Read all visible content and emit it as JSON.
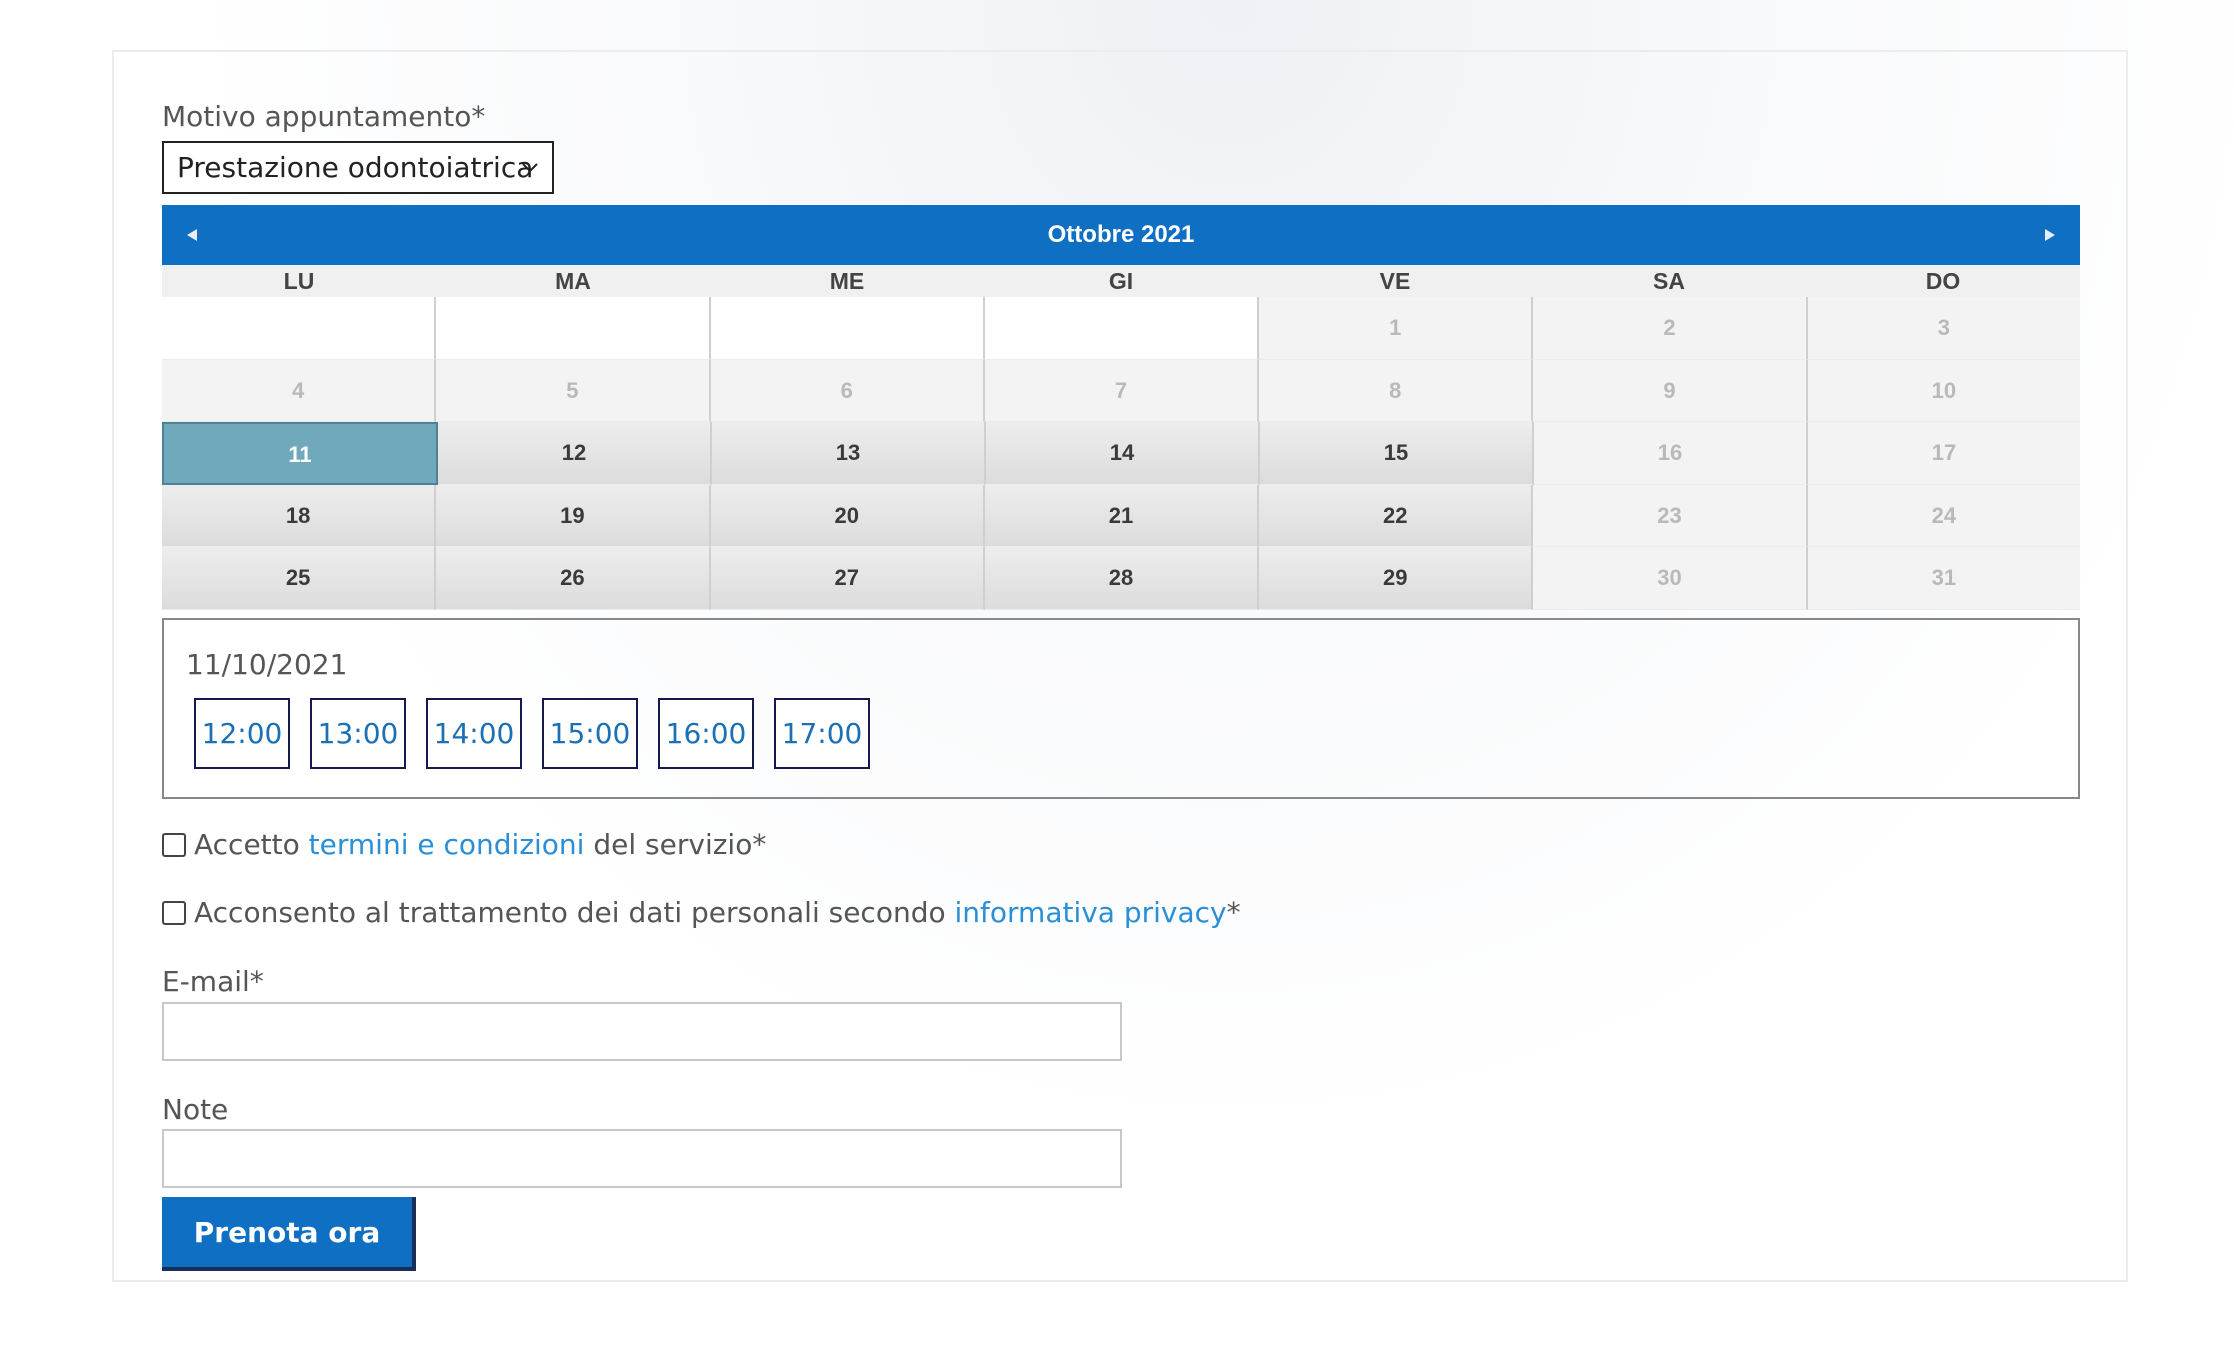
{
  "form": {
    "reason_label": "Motivo appuntamento*",
    "reason_value": "Prestazione odontoiatrica",
    "calendar": {
      "month_title": "Ottobre 2021",
      "prev_icon": "triangle-left-icon",
      "next_icon": "triangle-right-icon",
      "weekdays": [
        "LU",
        "MA",
        "ME",
        "GI",
        "VE",
        "SA",
        "DO"
      ],
      "weeks": [
        [
          {
            "label": "",
            "state": "empty"
          },
          {
            "label": "",
            "state": "empty"
          },
          {
            "label": "",
            "state": "empty"
          },
          {
            "label": "",
            "state": "empty"
          },
          {
            "label": "1",
            "state": "disabled"
          },
          {
            "label": "2",
            "state": "disabled"
          },
          {
            "label": "3",
            "state": "disabled"
          }
        ],
        [
          {
            "label": "4",
            "state": "disabled"
          },
          {
            "label": "5",
            "state": "disabled"
          },
          {
            "label": "6",
            "state": "disabled"
          },
          {
            "label": "7",
            "state": "disabled"
          },
          {
            "label": "8",
            "state": "disabled"
          },
          {
            "label": "9",
            "state": "disabled"
          },
          {
            "label": "10",
            "state": "disabled"
          }
        ],
        [
          {
            "label": "11",
            "state": "selected"
          },
          {
            "label": "12",
            "state": "available"
          },
          {
            "label": "13",
            "state": "available"
          },
          {
            "label": "14",
            "state": "available"
          },
          {
            "label": "15",
            "state": "available"
          },
          {
            "label": "16",
            "state": "disabled"
          },
          {
            "label": "17",
            "state": "disabled"
          }
        ],
        [
          {
            "label": "18",
            "state": "available"
          },
          {
            "label": "19",
            "state": "available"
          },
          {
            "label": "20",
            "state": "available"
          },
          {
            "label": "21",
            "state": "available"
          },
          {
            "label": "22",
            "state": "available"
          },
          {
            "label": "23",
            "state": "disabled"
          },
          {
            "label": "24",
            "state": "disabled"
          }
        ],
        [
          {
            "label": "25",
            "state": "available"
          },
          {
            "label": "26",
            "state": "available"
          },
          {
            "label": "27",
            "state": "available"
          },
          {
            "label": "28",
            "state": "available"
          },
          {
            "label": "29",
            "state": "available"
          },
          {
            "label": "30",
            "state": "disabled"
          },
          {
            "label": "31",
            "state": "disabled"
          }
        ]
      ]
    },
    "selected_date": "11/10/2021",
    "time_slots": [
      "12:00",
      "13:00",
      "14:00",
      "15:00",
      "16:00",
      "17:00"
    ],
    "terms": {
      "prefix": "Accetto ",
      "link": "termini e condizioni",
      "suffix": " del servizio*"
    },
    "privacy": {
      "prefix": "Acconsento al trattamento dei dati personali secondo ",
      "link": "informativa privacy",
      "suffix": "*"
    },
    "email_label": "E-mail*",
    "email_value": "",
    "notes_label": "Note",
    "notes_value": "",
    "submit_label": "Prenota ora"
  },
  "colors": {
    "primary": "#0f6fc2",
    "selected_day": "#6fa9bb",
    "link": "#2a8fd6",
    "slot_text": "#1a6fb5"
  }
}
